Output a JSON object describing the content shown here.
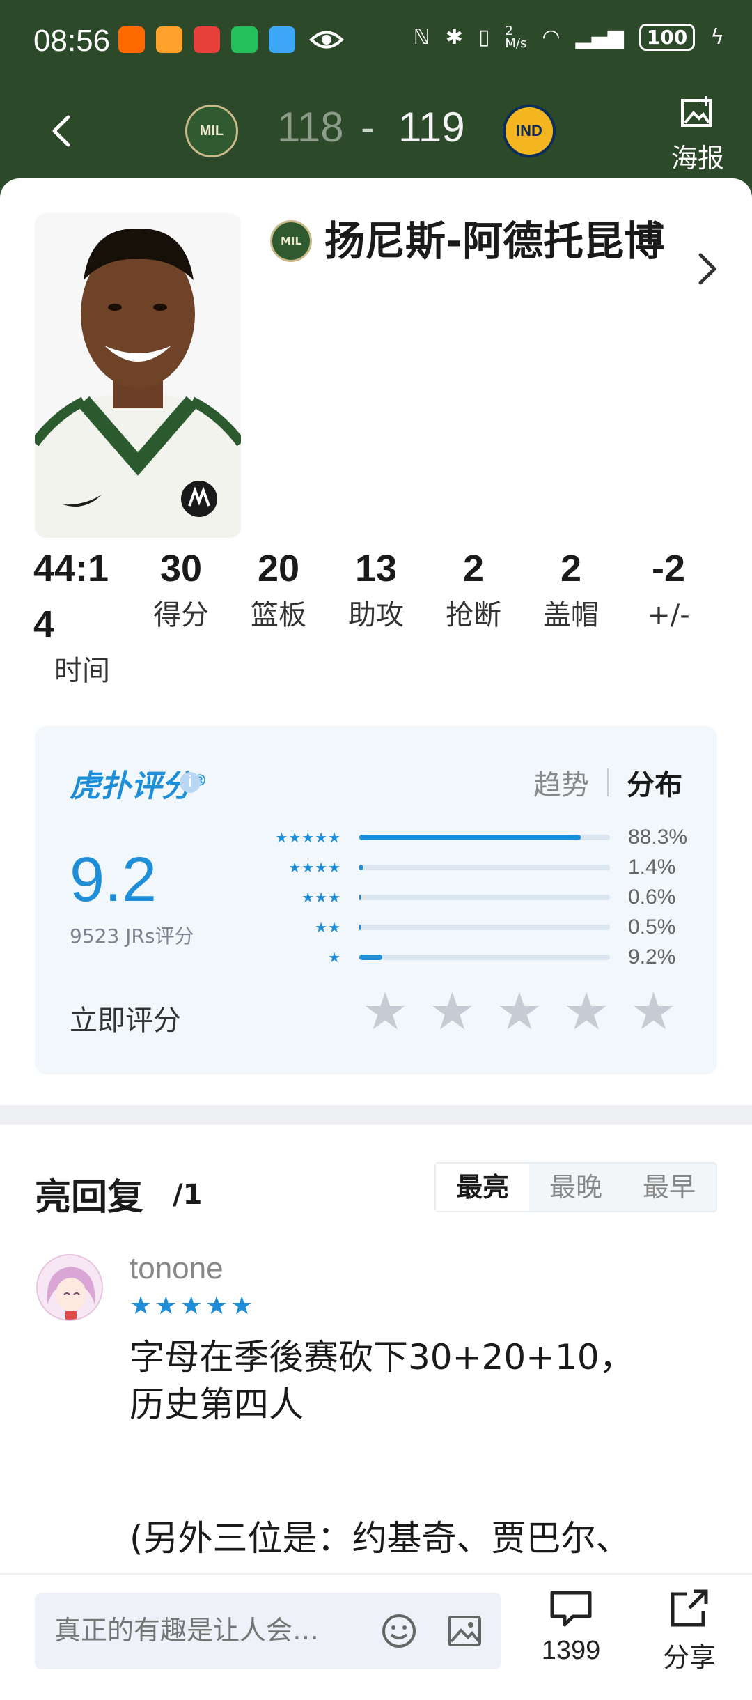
{
  "status_bar": {
    "time": "08:56",
    "network_speed": "2\nM/s",
    "battery": "100",
    "colors": {
      "bg": "#2c4a2a",
      "fg": "#ffffff"
    }
  },
  "header": {
    "home_team_abbr": "MIL",
    "away_team_abbr": "IND",
    "home_score": "118",
    "separator": "-",
    "away_score": "119",
    "poster_label": "海报"
  },
  "player": {
    "name": "扬尼斯-阿德托昆博",
    "team_abbr": "MIL"
  },
  "stats": [
    {
      "value": "44:14",
      "label": "时间"
    },
    {
      "value": "30",
      "label": "得分"
    },
    {
      "value": "20",
      "label": "篮板"
    },
    {
      "value": "13",
      "label": "助攻"
    },
    {
      "value": "2",
      "label": "抢断"
    },
    {
      "value": "2",
      "label": "盖帽"
    },
    {
      "value": "-2",
      "label": "+/-"
    }
  ],
  "rating": {
    "brand": "虎扑评分",
    "tab_trend": "趋势",
    "tab_distribution": "分布",
    "score": "9.2",
    "count_text": "9523 JRs评分",
    "rate_now": "立即评分",
    "distribution": [
      {
        "stars": 5,
        "percent": "88.3%",
        "fraction": 0.883
      },
      {
        "stars": 4,
        "percent": "1.4%",
        "fraction": 0.014
      },
      {
        "stars": 3,
        "percent": "0.6%",
        "fraction": 0.006
      },
      {
        "stars": 2,
        "percent": "0.5%",
        "fraction": 0.005
      },
      {
        "stars": 1,
        "percent": "9.2%",
        "fraction": 0.092
      }
    ],
    "accent_color": "#1e8ed8"
  },
  "replies": {
    "title": "亮回复",
    "count": "/1",
    "sort_tabs": [
      "最亮",
      "最晚",
      "最早"
    ],
    "active_sort": "最亮",
    "first": {
      "username": "tonone",
      "stars": 5,
      "lines": [
        "字母在季後赛砍下30+20+10，",
        "历史第四人",
        "(另外三位是：约基奇、贾巴尔、"
      ]
    }
  },
  "bottom_bar": {
    "input_placeholder": "真正的有趣是让人会…",
    "comment_count": "1399",
    "share_label": "分享"
  }
}
